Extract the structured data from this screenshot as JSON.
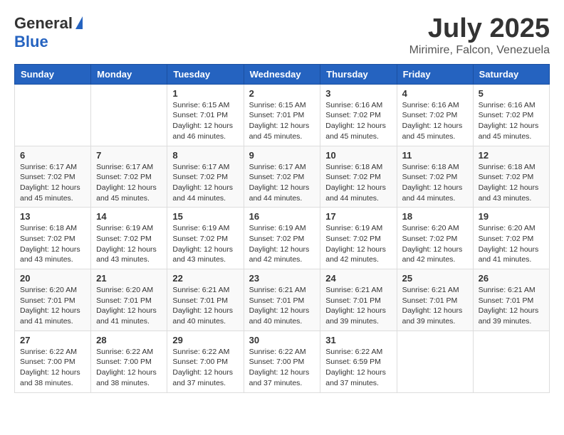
{
  "header": {
    "logo_general": "General",
    "logo_blue": "Blue",
    "month_title": "July 2025",
    "location": "Mirimire, Falcon, Venezuela"
  },
  "days_of_week": [
    "Sunday",
    "Monday",
    "Tuesday",
    "Wednesday",
    "Thursday",
    "Friday",
    "Saturday"
  ],
  "weeks": [
    [
      {
        "day": null
      },
      {
        "day": null
      },
      {
        "day": "1",
        "sunrise": "6:15 AM",
        "sunset": "7:01 PM",
        "daylight": "12 hours and 46 minutes."
      },
      {
        "day": "2",
        "sunrise": "6:15 AM",
        "sunset": "7:01 PM",
        "daylight": "12 hours and 45 minutes."
      },
      {
        "day": "3",
        "sunrise": "6:16 AM",
        "sunset": "7:02 PM",
        "daylight": "12 hours and 45 minutes."
      },
      {
        "day": "4",
        "sunrise": "6:16 AM",
        "sunset": "7:02 PM",
        "daylight": "12 hours and 45 minutes."
      },
      {
        "day": "5",
        "sunrise": "6:16 AM",
        "sunset": "7:02 PM",
        "daylight": "12 hours and 45 minutes."
      }
    ],
    [
      {
        "day": "6",
        "sunrise": "6:17 AM",
        "sunset": "7:02 PM",
        "daylight": "12 hours and 45 minutes."
      },
      {
        "day": "7",
        "sunrise": "6:17 AM",
        "sunset": "7:02 PM",
        "daylight": "12 hours and 45 minutes."
      },
      {
        "day": "8",
        "sunrise": "6:17 AM",
        "sunset": "7:02 PM",
        "daylight": "12 hours and 44 minutes."
      },
      {
        "day": "9",
        "sunrise": "6:17 AM",
        "sunset": "7:02 PM",
        "daylight": "12 hours and 44 minutes."
      },
      {
        "day": "10",
        "sunrise": "6:18 AM",
        "sunset": "7:02 PM",
        "daylight": "12 hours and 44 minutes."
      },
      {
        "day": "11",
        "sunrise": "6:18 AM",
        "sunset": "7:02 PM",
        "daylight": "12 hours and 44 minutes."
      },
      {
        "day": "12",
        "sunrise": "6:18 AM",
        "sunset": "7:02 PM",
        "daylight": "12 hours and 43 minutes."
      }
    ],
    [
      {
        "day": "13",
        "sunrise": "6:18 AM",
        "sunset": "7:02 PM",
        "daylight": "12 hours and 43 minutes."
      },
      {
        "day": "14",
        "sunrise": "6:19 AM",
        "sunset": "7:02 PM",
        "daylight": "12 hours and 43 minutes."
      },
      {
        "day": "15",
        "sunrise": "6:19 AM",
        "sunset": "7:02 PM",
        "daylight": "12 hours and 43 minutes."
      },
      {
        "day": "16",
        "sunrise": "6:19 AM",
        "sunset": "7:02 PM",
        "daylight": "12 hours and 42 minutes."
      },
      {
        "day": "17",
        "sunrise": "6:19 AM",
        "sunset": "7:02 PM",
        "daylight": "12 hours and 42 minutes."
      },
      {
        "day": "18",
        "sunrise": "6:20 AM",
        "sunset": "7:02 PM",
        "daylight": "12 hours and 42 minutes."
      },
      {
        "day": "19",
        "sunrise": "6:20 AM",
        "sunset": "7:02 PM",
        "daylight": "12 hours and 41 minutes."
      }
    ],
    [
      {
        "day": "20",
        "sunrise": "6:20 AM",
        "sunset": "7:01 PM",
        "daylight": "12 hours and 41 minutes."
      },
      {
        "day": "21",
        "sunrise": "6:20 AM",
        "sunset": "7:01 PM",
        "daylight": "12 hours and 41 minutes."
      },
      {
        "day": "22",
        "sunrise": "6:21 AM",
        "sunset": "7:01 PM",
        "daylight": "12 hours and 40 minutes."
      },
      {
        "day": "23",
        "sunrise": "6:21 AM",
        "sunset": "7:01 PM",
        "daylight": "12 hours and 40 minutes."
      },
      {
        "day": "24",
        "sunrise": "6:21 AM",
        "sunset": "7:01 PM",
        "daylight": "12 hours and 39 minutes."
      },
      {
        "day": "25",
        "sunrise": "6:21 AM",
        "sunset": "7:01 PM",
        "daylight": "12 hours and 39 minutes."
      },
      {
        "day": "26",
        "sunrise": "6:21 AM",
        "sunset": "7:01 PM",
        "daylight": "12 hours and 39 minutes."
      }
    ],
    [
      {
        "day": "27",
        "sunrise": "6:22 AM",
        "sunset": "7:00 PM",
        "daylight": "12 hours and 38 minutes."
      },
      {
        "day": "28",
        "sunrise": "6:22 AM",
        "sunset": "7:00 PM",
        "daylight": "12 hours and 38 minutes."
      },
      {
        "day": "29",
        "sunrise": "6:22 AM",
        "sunset": "7:00 PM",
        "daylight": "12 hours and 37 minutes."
      },
      {
        "day": "30",
        "sunrise": "6:22 AM",
        "sunset": "7:00 PM",
        "daylight": "12 hours and 37 minutes."
      },
      {
        "day": "31",
        "sunrise": "6:22 AM",
        "sunset": "6:59 PM",
        "daylight": "12 hours and 37 minutes."
      },
      {
        "day": null
      },
      {
        "day": null
      }
    ]
  ]
}
